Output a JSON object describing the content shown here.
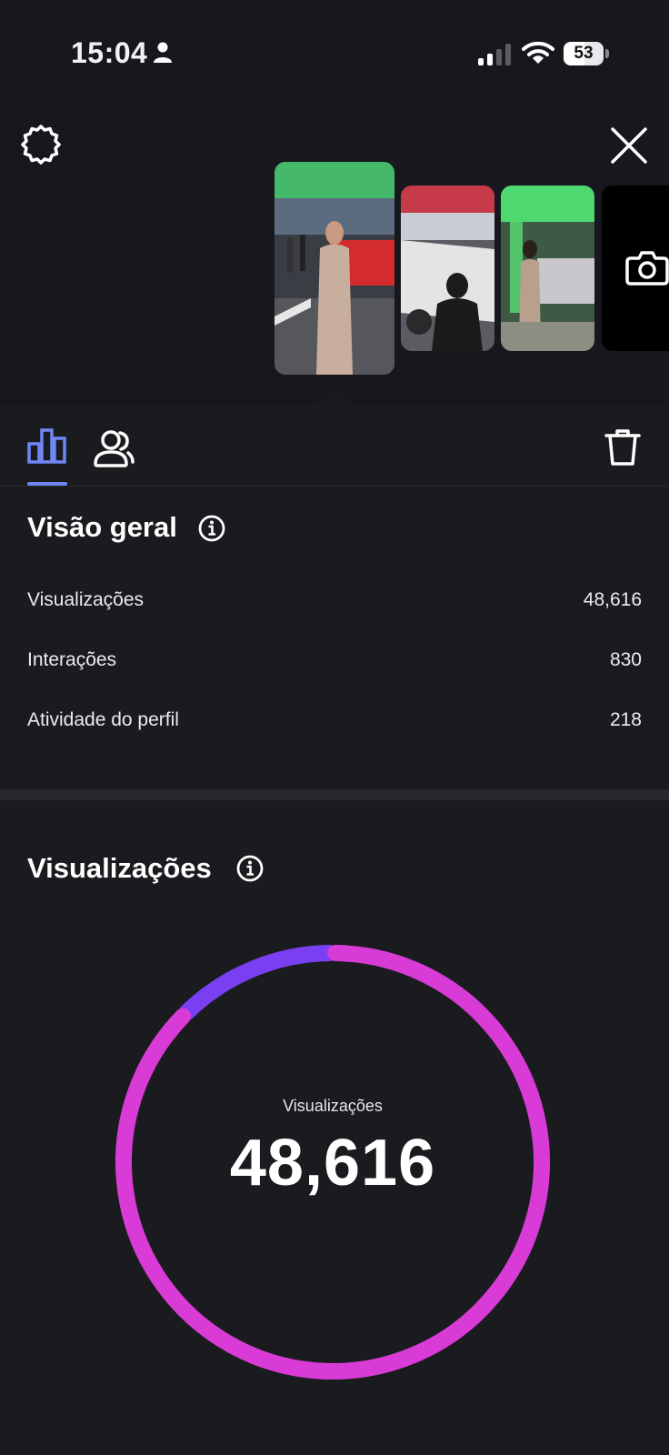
{
  "status_bar": {
    "time": "15:04",
    "battery": "53",
    "battery_level": 0.53
  },
  "story_thumbnails": [
    {
      "name": "thumbnail-1",
      "selected": true
    },
    {
      "name": "thumbnail-2",
      "selected": false
    },
    {
      "name": "thumbnail-3",
      "selected": false
    }
  ],
  "overview": {
    "title": "Visão geral",
    "rows": [
      {
        "label": "Visualizações",
        "value": "48,616"
      },
      {
        "label": "Interações",
        "value": "830"
      },
      {
        "label": "Atividade do perfil",
        "value": "218"
      }
    ]
  },
  "views": {
    "title": "Visualizações",
    "center_label": "Visualizações",
    "center_value": "48,616"
  },
  "chart_data": {
    "type": "pie",
    "series": [
      {
        "values": [
          0.125,
          0.875
        ]
      }
    ],
    "colors": [
      "#7b3ff2",
      "#d93bd6"
    ]
  },
  "colors": {
    "accent_tab": "#6f86f5",
    "ring_primary": "#d93bd6",
    "ring_secondary": "#7b3ff2",
    "background": "#1a1b1f"
  },
  "icons": [
    "person-icon",
    "signal-icon",
    "wifi-icon",
    "gear-icon",
    "close-icon",
    "camera-icon",
    "bar-chart-icon",
    "audience-icon",
    "trash-icon",
    "info-icon"
  ]
}
